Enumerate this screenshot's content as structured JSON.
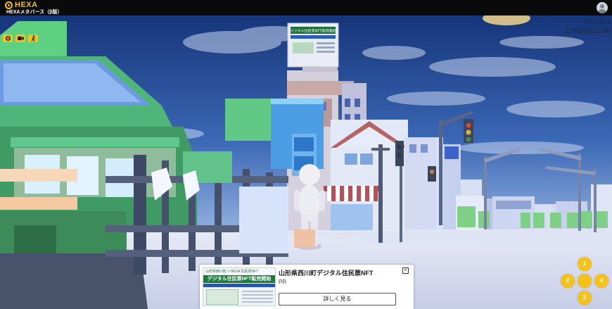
{
  "header": {
    "logo_text": "HEXA",
    "app_subtitle": "HEXAメタバース（β版）",
    "profile_icon": "user-avatar-icon"
  },
  "toolbar": {
    "items": [
      {
        "icon": "settings-gear-icon"
      },
      {
        "icon": "video-camera-icon"
      },
      {
        "icon": "walk-mode-icon"
      }
    ]
  },
  "hud": {
    "fps_label": "FPS:",
    "fps_value": "36.9",
    "land_label": "LAND#1",
    "land_coords": "(51,49)"
  },
  "billboard": {
    "title": "デジタル住民票NFT販売開始"
  },
  "ad": {
    "thumb_top": "山形県西川町 × HEXA 住民票NFT",
    "thumb_main": "デジタル住民票NFT販売開始",
    "title": "山形県西川町デジタル住民票NFT",
    "tag": "PR",
    "more_label": "詳しく見る",
    "close_icon": "close-x-icon"
  },
  "dpad": {
    "up": "1",
    "left": "2",
    "down": "3",
    "right": "4"
  },
  "colors": {
    "accent": "#f4c21a",
    "sky": "#2c4f96",
    "ground": "#d9def2"
  }
}
